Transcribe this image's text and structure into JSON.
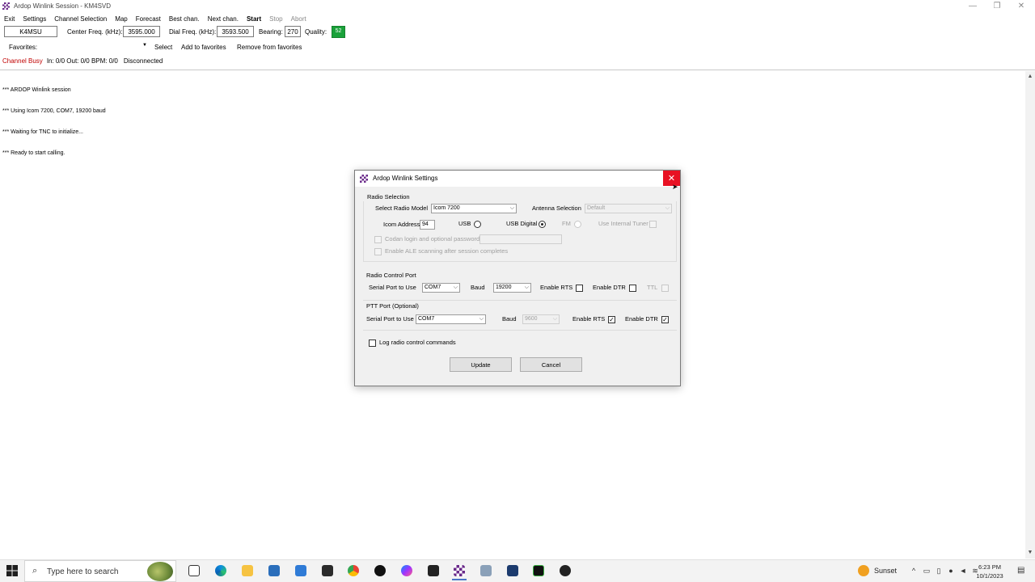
{
  "window": {
    "title": "Ardop Winlink Session - KM4SVD",
    "minimize": "—",
    "maximize": "❐",
    "close": "✕"
  },
  "menu": {
    "items": [
      "Exit",
      "Settings",
      "Channel Selection",
      "Map",
      "Forecast",
      "Best chan.",
      "Next chan.",
      "Start",
      "Stop",
      "Abort"
    ]
  },
  "toolbar": {
    "callsign": "K4MSU",
    "center_freq_label": "Center Freq. (kHz):",
    "center_freq": "3595.000",
    "dial_freq_label": "Dial Freq. (kHz):",
    "dial_freq": "3593.500",
    "bearing_label": "Bearing:",
    "bearing": "270",
    "quality_label": "Quality:",
    "quality": "52",
    "quality_color": "#1aa13a"
  },
  "favorites": {
    "label": "Favorites:",
    "selected": "",
    "select_label": "Select",
    "add_label": "Add to favorites",
    "remove_label": "Remove from favorites"
  },
  "status": {
    "channel_busy": "Channel Busy",
    "counts": "In: 0/0  Out: 0/0  BPM: 0/0",
    "connection": "Disconnected"
  },
  "log": {
    "lines": [
      "*** ARDOP Winlink session",
      "*** Using Icom 7200, COM7, 19200 baud",
      "*** Waiting for TNC to initialize...",
      "*** Ready to start calling."
    ]
  },
  "dialog": {
    "title": "Ardop Winlink Settings",
    "radio_selection_title": "Radio Selection",
    "select_radio_model_label": "Select Radio Model",
    "radio_model": "Icom 7200",
    "antenna_selection_label": "Antenna Selection",
    "antenna_selection": "Default",
    "icom_address_label": "Icom Address",
    "icom_address": "94",
    "usb_label": "USB",
    "usb_digital_label": "USB Digital",
    "fm_label": "FM",
    "internal_tuner_label": "Use Internal Tuner",
    "codan_label": "Codan login and optional password:",
    "codan_value": "",
    "ale_label": "Enable ALE scanning after session completes",
    "radio_control_title": "Radio Control Port",
    "serial_port_label": "Serial Port to Use",
    "serial_port": "COM7",
    "baud_label": "Baud",
    "baud": "19200",
    "enable_rts_label": "Enable RTS",
    "enable_dtr_label": "Enable DTR",
    "ttl_label": "TTL",
    "ptt_title": "PTT Port (Optional)",
    "ptt_serial_port_label": "Serial Port to Use",
    "ptt_serial_port": "COM7",
    "ptt_baud_label": "Baud",
    "ptt_baud": "9600",
    "ptt_rts_label": "Enable RTS",
    "ptt_dtr_label": "Enable DTR",
    "log_commands_label": "Log radio control commands",
    "update_label": "Update",
    "cancel_label": "Cancel",
    "radio_mode": "USB Digital",
    "ptt_rts_checked": true,
    "ptt_dtr_checked": true,
    "close_color": "#e81123"
  },
  "taskbar": {
    "search_placeholder": "Type here to search",
    "weather": "Sunset",
    "time": "6:23 PM",
    "date": "10/1/2023",
    "apps": [
      "task-view-icon",
      "edge-icon",
      "file-explorer-icon",
      "store-icon",
      "mail-icon",
      "terminal-icon",
      "chrome-icon",
      "tiktok-icon",
      "messenger-icon",
      "capcut-icon",
      "winlink-icon",
      "ardop-icon",
      "app-icon",
      "vara-icon",
      "record-icon"
    ]
  }
}
